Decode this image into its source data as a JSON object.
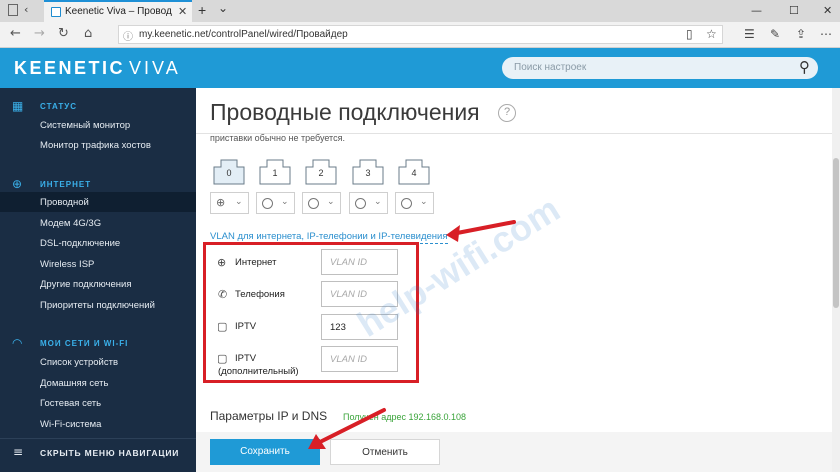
{
  "browser": {
    "tab_title": "Keenetic Viva – Провод",
    "tab_close": "✕",
    "new_tab": "+",
    "tab_list": "⌄",
    "url": "my.keenetic.net/controlPanel/wired/Провайдер"
  },
  "app": {
    "logo": "KEENETIC",
    "model": "VIVA",
    "search_placeholder": "Поиск настроек"
  },
  "sidebar": {
    "status_header": "СТАТУС",
    "status_items": [
      "Системный монитор",
      "Монитор трафика хостов"
    ],
    "internet_header": "ИНТЕРНЕТ",
    "internet_items": [
      "Проводной",
      "Модем 4G/3G",
      "DSL-подключение",
      "Wireless ISP",
      "Другие подключения",
      "Приоритеты подключений"
    ],
    "wifi_header": "МОИ СЕТИ И WI-FI",
    "wifi_items": [
      "Список устройств",
      "Домашняя сеть",
      "Гостевая сеть",
      "Wi-Fi-система"
    ],
    "footer": "СКРЫТЬ МЕНЮ НАВИГАЦИИ"
  },
  "page": {
    "title": "Проводные подключения",
    "help": "?",
    "note": "приставки обычно не требуется.",
    "ports": [
      "0",
      "1",
      "2",
      "3",
      "4"
    ],
    "vlan_link": "VLAN для интернета, IP-телефонии и IP-телевидения",
    "vlan": {
      "placeholder": "VLAN ID",
      "internet_label": "Интернет",
      "internet_value": "",
      "telephony_label": "Телефония",
      "telephony_value": "",
      "iptv_label": "IPTV",
      "iptv_value": "123",
      "iptv_extra_label": "IPTV",
      "iptv_extra_sub": "(дополнительный)",
      "iptv_extra_value": ""
    },
    "ip_title": "Параметры IP и DNS",
    "ip_status": "Получен адрес 192.168.0.108",
    "save": "Сохранить",
    "cancel": "Отменить"
  },
  "watermark": "help-wifi.com",
  "colors": {
    "brand": "#1f9ad6",
    "sidebar": "#1a2d44",
    "highlight": "#d81f26"
  }
}
